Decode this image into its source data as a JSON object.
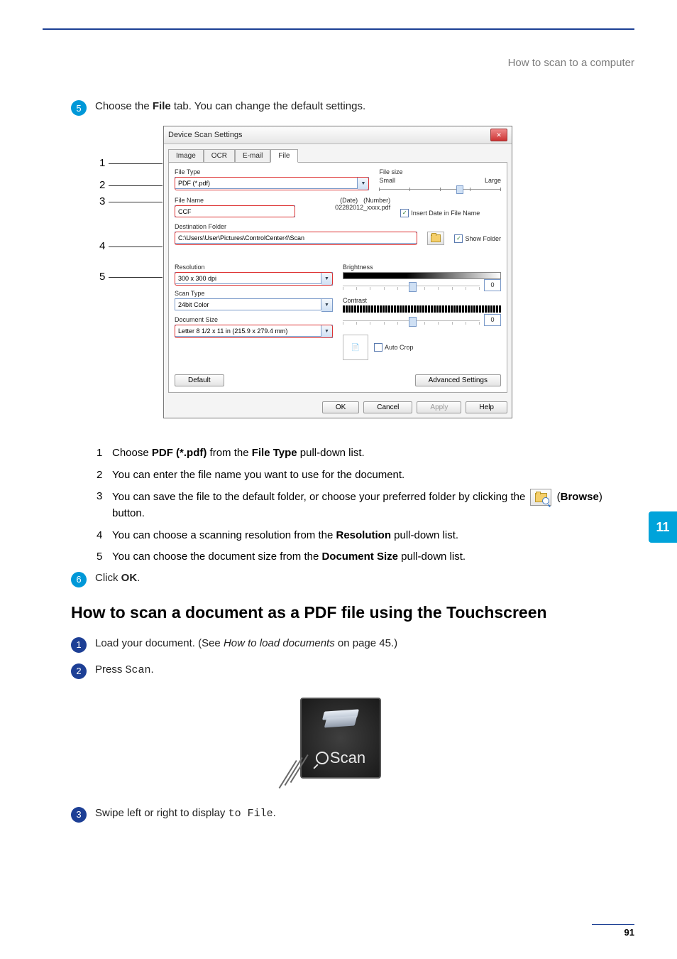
{
  "breadcrumb": "How to scan to a computer",
  "step5": {
    "num": "5",
    "text_pre": "Choose the ",
    "bold": "File",
    "text_post": " tab. You can change the default settings."
  },
  "callouts": [
    "1",
    "2",
    "3",
    "4",
    "5"
  ],
  "dialog": {
    "title": "Device Scan Settings",
    "tabs": {
      "image": "Image",
      "ocr": "OCR",
      "email": "E-mail",
      "file": "File"
    },
    "file_type_label": "File Type",
    "file_type_value": "PDF (*.pdf)",
    "file_size_label": "File size",
    "file_size_small": "Small",
    "file_size_large": "Large",
    "file_name_label": "File Name",
    "file_name_value": "CCF",
    "file_name_date_label": "(Date)",
    "file_name_number_label": "(Number)",
    "file_name_preview": "02282012_xxxx.pdf",
    "insert_date_label": "Insert Date in File Name",
    "dest_label": "Destination Folder",
    "dest_value": "C:\\Users\\User\\Pictures\\ControlCenter4\\Scan",
    "show_folder_label": "Show Folder",
    "resolution_label": "Resolution",
    "resolution_value": "300 x 300 dpi",
    "scan_type_label": "Scan Type",
    "scan_type_value": "24bit Color",
    "doc_size_label": "Document Size",
    "doc_size_value": "Letter 8 1/2 x 11 in (215.9 x 279.4 mm)",
    "brightness_label": "Brightness",
    "brightness_value": "0",
    "contrast_label": "Contrast",
    "contrast_value": "0",
    "auto_crop_label": "Auto Crop",
    "default_btn": "Default",
    "advanced_btn": "Advanced Settings",
    "ok": "OK",
    "cancel": "Cancel",
    "apply": "Apply",
    "help": "Help"
  },
  "instr": {
    "i1": {
      "n": "1",
      "pre": "Choose ",
      "b1": "PDF (*.pdf)",
      "mid": " from the ",
      "b2": "File Type",
      "post": " pull-down list."
    },
    "i2": {
      "n": "2",
      "text": "You can enter the file name you want to use for the document."
    },
    "i3": {
      "n": "3",
      "pre": "You can save the file to the default folder, or choose your preferred folder by clicking the ",
      "browse_label": "Browse",
      "post": ") button."
    },
    "i4": {
      "n": "4",
      "pre": "You can choose a scanning resolution from the ",
      "b": "Resolution",
      "post": " pull-down list."
    },
    "i5": {
      "n": "5",
      "pre": "You can choose the document size from the ",
      "b": "Document Size",
      "post": " pull-down list."
    }
  },
  "step6": {
    "num": "6",
    "pre": "Click ",
    "b": "OK",
    "post": "."
  },
  "section_title": "How to scan a document as a PDF file using the Touchscreen",
  "ts1": {
    "num": "1",
    "pre": "Load your document. (See ",
    "link": "How to load documents",
    "post": " on page 45.)"
  },
  "ts2": {
    "num": "2",
    "pre": "Press ",
    "code": "Scan",
    "post": "."
  },
  "scan_icon_label": "Scan",
  "ts3": {
    "num": "3",
    "pre": "Swipe left or right to display ",
    "code": "to File",
    "post": "."
  },
  "side_tab": "11",
  "page_number": "91"
}
